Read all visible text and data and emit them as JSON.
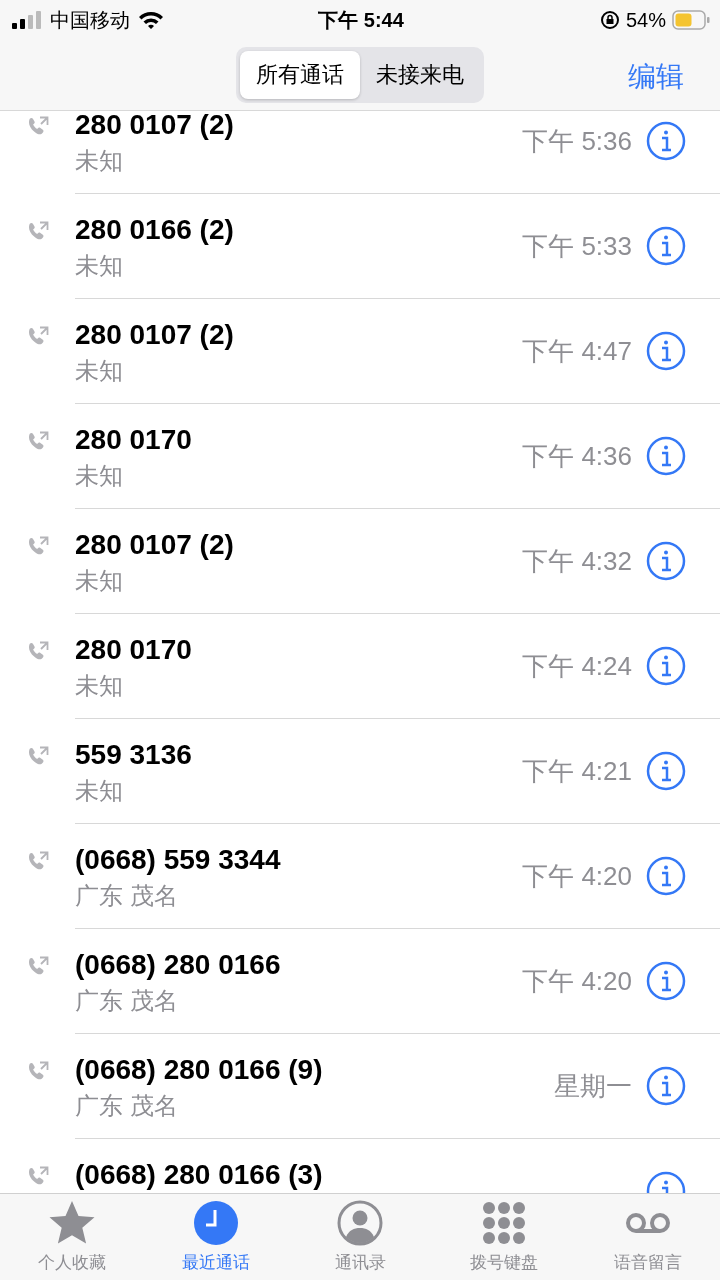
{
  "status_bar": {
    "carrier": "中国移动",
    "time": "下午 5:44",
    "battery": "54%"
  },
  "segments": [
    {
      "label": "所有通话",
      "selected": true
    },
    {
      "label": "未接来电",
      "selected": false
    }
  ],
  "edit_button": "编辑",
  "calls": [
    {
      "number": "280 0107 (2)",
      "location": "未知",
      "time": "下午 5:36"
    },
    {
      "number": "280 0166 (2)",
      "location": "未知",
      "time": "下午 5:33"
    },
    {
      "number": "280 0107 (2)",
      "location": "未知",
      "time": "下午 4:47"
    },
    {
      "number": "280 0170",
      "location": "未知",
      "time": "下午 4:36"
    },
    {
      "number": "280 0107 (2)",
      "location": "未知",
      "time": "下午 4:32"
    },
    {
      "number": "280 0170",
      "location": "未知",
      "time": "下午 4:24"
    },
    {
      "number": "559 3136",
      "location": "未知",
      "time": "下午 4:21"
    },
    {
      "number": "(0668) 559 3344",
      "location": "广东 茂名",
      "time": "下午 4:20"
    },
    {
      "number": "(0668) 280 0166",
      "location": "广东 茂名",
      "time": "下午 4:20"
    },
    {
      "number": "(0668) 280 0166 (9)",
      "location": "广东 茂名",
      "time": "星期一"
    },
    {
      "number": "(0668) 280 0166 (3)"
    }
  ],
  "tab_bar": [
    {
      "kind": "star",
      "label": "个人收藏",
      "selected": false
    },
    {
      "kind": "clock",
      "label": "最近通话",
      "selected": true
    },
    {
      "kind": "contact",
      "label": "通讯录",
      "selected": false
    },
    {
      "kind": "keypad",
      "label": "拨号键盘",
      "selected": false
    },
    {
      "kind": "voicemail",
      "label": "语音留言",
      "selected": false
    }
  ]
}
